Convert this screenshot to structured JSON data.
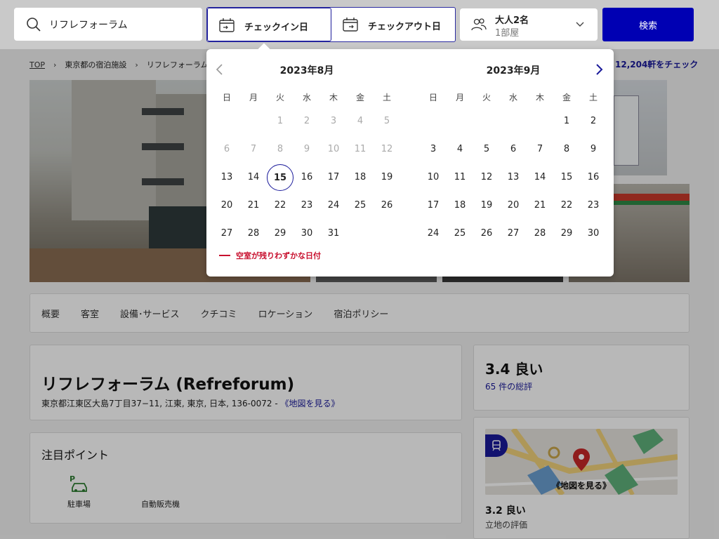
{
  "search": {
    "destination": "リフレフォーラム",
    "button_label": "検索"
  },
  "dates": {
    "checkin_label": "チェックイン日",
    "checkout_label": "チェックアウト日"
  },
  "guests": {
    "adults": "大人2名",
    "rooms": "1部屋"
  },
  "breadcrumb": {
    "items": [
      "TOP",
      "東京都の宿泊施設",
      "リフレフォーラム"
    ]
  },
  "check_note": "12,204軒をチェック",
  "tabs": [
    "概要",
    "客室",
    "設備･サービス",
    "クチコミ",
    "ロケーション",
    "宿泊ポリシー"
  ],
  "property": {
    "name": "リフレフォーラム (Refreforum)",
    "address": "東京都江東区大島7丁目37−11, 江東, 東京, 日本, 136-0072 - ",
    "map_link": "《地図を見る》"
  },
  "highlights": {
    "title": "注目ポイント",
    "amenities": [
      "駐車場",
      "自動販売機"
    ]
  },
  "rating": {
    "score": "3.4 良い",
    "reviews": "65 件の総評"
  },
  "location": {
    "map_label": "《地図を見る》",
    "score": "3.2 良い",
    "label": "立地の評価"
  },
  "calendar": {
    "weekdays": [
      "日",
      "月",
      "火",
      "水",
      "木",
      "金",
      "土"
    ],
    "months": [
      {
        "title": "2023年8月",
        "first_weekday": 2,
        "days": 31,
        "disabled_until": 13,
        "today": 15
      },
      {
        "title": "2023年9月",
        "first_weekday": 5,
        "days": 30,
        "disabled_until": 0,
        "today": 0
      }
    ],
    "legend": "空室が残りわずかな日付"
  },
  "colors": {
    "accent": "#0000b3",
    "link": "#1a1a9a",
    "alert": "#c8102e"
  }
}
